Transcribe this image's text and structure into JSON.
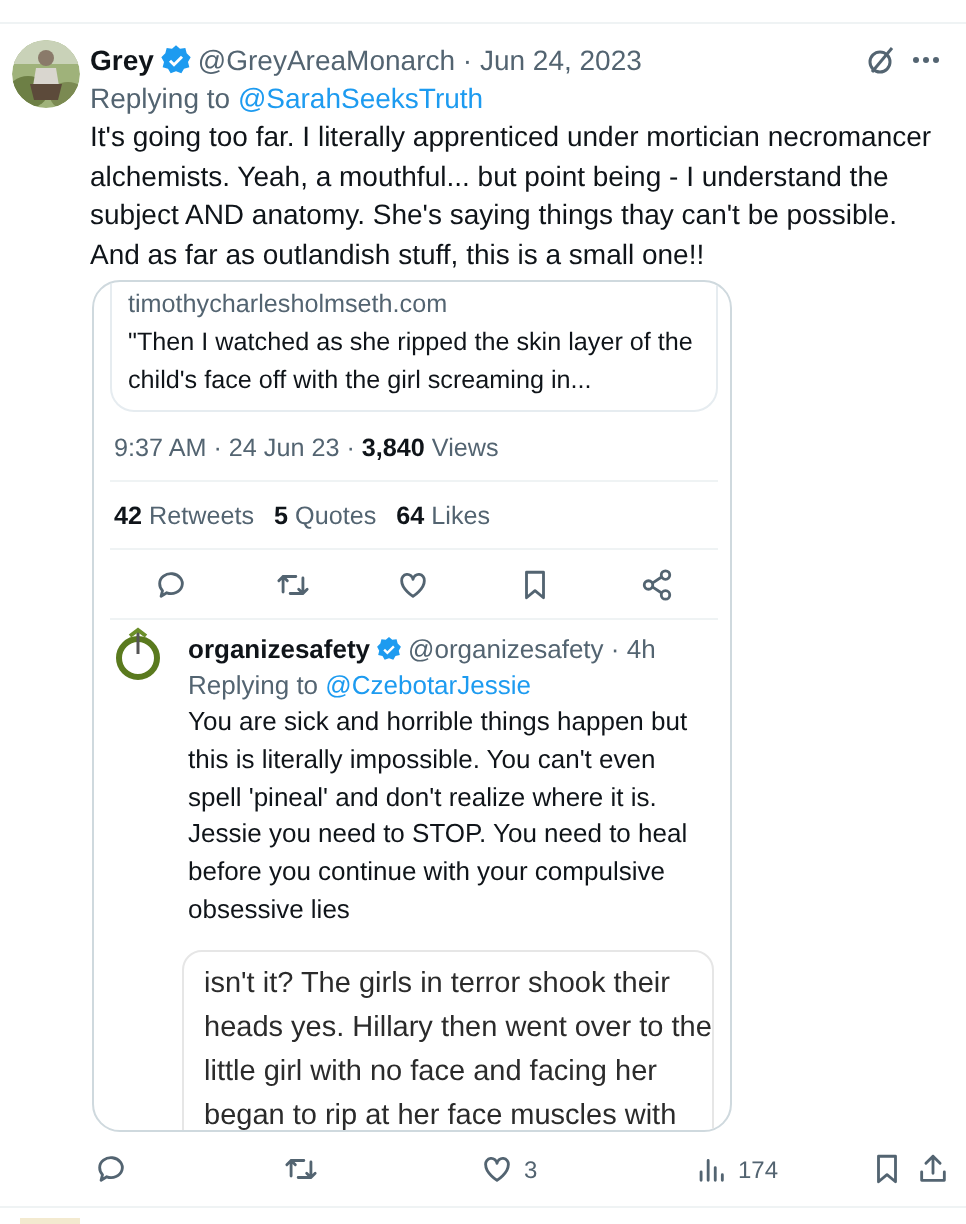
{
  "tweet": {
    "name": "Grey",
    "verified": true,
    "handle_date": "@GreyAreaMonarch · Jun 24, 2023",
    "replying_label": "Replying to",
    "replying_to": "@SarahSeeksTruth",
    "text": "It's going too far. I literally apprenticed under mortician necromancer alchemists.  Yeah, a mouthful... but point being - I understand the subject AND anatomy. She's saying things thay can't be possible. And as far as outlandish stuff, this is a small one!!",
    "attached_screenshot": {
      "link_card": {
        "domain": "timothycharlesholmseth.com",
        "text": "\"Then I watched as she ripped the skin layer of the child's face off with the girl screaming in..."
      },
      "meta": "9:37 AM · 24 Jun 23 · **3,840** Views",
      "stats": [
        "**42** Retweets",
        "**5** Quotes",
        "**64** Likes"
      ],
      "icons": [
        {
          "kind": "reply"
        },
        {
          "kind": "retweet"
        },
        {
          "kind": "like"
        },
        {
          "kind": "bookmark"
        },
        {
          "kind": "share"
        }
      ],
      "reply": {
        "name": "organizesafety",
        "verified": true,
        "handle_time": "@organizesafety · 4h",
        "replying_label": "Replying to",
        "replying_to": "@CzebotarJessie",
        "text": "You are sick and horrible things happen but this is literally impossible.  You can't even spell 'pineal' and don't realize where it is. Jessie you need to STOP. You need to heal before you continue with your compulsive obsessive lies",
        "quoted_lines": [
          "isn't it? The girls in terror shook their",
          "heads yes. Hillary then went over to the",
          "little girl with no face and facing her",
          "began to rip at her face muscles with"
        ]
      }
    },
    "actions": [
      {
        "kind": "reply"
      },
      {
        "kind": "retweet"
      },
      {
        "kind": "like",
        "count": "3"
      },
      {
        "kind": "views",
        "count": "174"
      },
      {
        "kind": "bookmark"
      },
      {
        "kind": "share"
      }
    ]
  }
}
